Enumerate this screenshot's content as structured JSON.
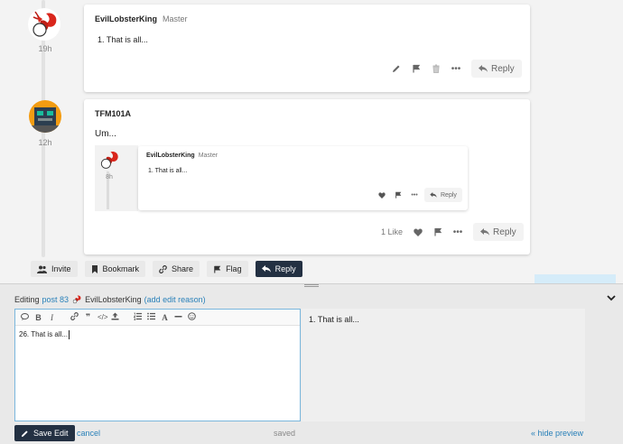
{
  "posts": [
    {
      "username": "EvilLobsterKing",
      "rank": "Master",
      "age": "19h",
      "content": "1.  That is all...",
      "reply_label": "Reply"
    },
    {
      "username": "TFM101A",
      "rank": "",
      "age": "12h",
      "content": "Um...",
      "likes": "1 Like",
      "reply_label": "Reply",
      "quote": {
        "username": "EvilLobsterKing",
        "rank": "Master",
        "age": "8h",
        "content": "1.  That is all...",
        "reply_label": "Reply"
      }
    }
  ],
  "topic_footer": {
    "invite": "Invite",
    "bookmark": "Bookmark",
    "share": "Share",
    "flag": "Flag",
    "reply": "Reply"
  },
  "composer": {
    "editing_label": "Editing",
    "post_link": "post 83",
    "username": "EvilLobsterKing",
    "edit_reason": "(add edit reason)",
    "editor_text": "26. That is all...",
    "preview_text": "1.  That is all...",
    "save_label": "Save Edit",
    "cancel_label": "cancel",
    "status": "saved",
    "hide_preview": "« hide preview"
  },
  "colors": {
    "accent_link": "#2980b9",
    "primary_button": "#233042",
    "editor_border": "#7ab7dd"
  }
}
